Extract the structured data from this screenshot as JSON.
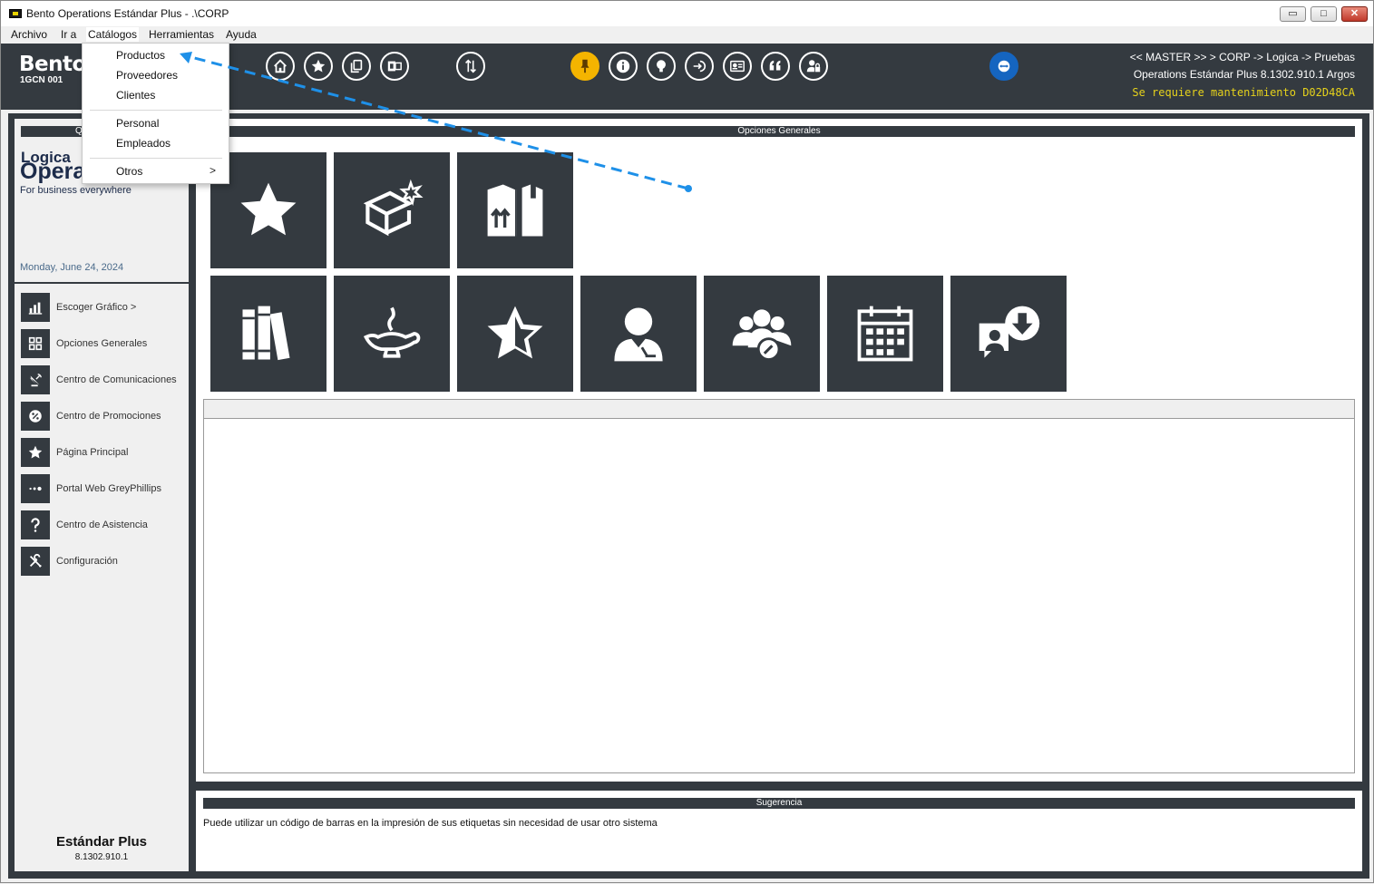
{
  "window": {
    "title": "Bento Operations Estándar Plus - .\\CORP",
    "min_glyph": "▭",
    "max_glyph": "□",
    "close_glyph": "✕"
  },
  "menubar": {
    "items": [
      {
        "label": "Archivo"
      },
      {
        "label": "Ir a"
      },
      {
        "label": "Catálogos"
      },
      {
        "label": "Herramientas"
      },
      {
        "label": "Ayuda"
      }
    ]
  },
  "dropdown": {
    "items": [
      "Productos",
      "Proveedores",
      "Clientes",
      "Personal",
      "Empleados",
      "Otros"
    ],
    "submenu_arrow": ">"
  },
  "header": {
    "brand": "Bento",
    "code": "1GCN 001",
    "path": "<< MASTER >> > CORP -> Logica -> Pruebas",
    "version": "Operations Estándar Plus 8.1302.910.1 Argos",
    "maintenance": "Se requiere mantenimiento D02D48CA",
    "icons": [
      "home-icon",
      "star-icon",
      "copy-icon",
      "office-icon",
      "sort-arrows-icon",
      "pin-icon",
      "info-icon",
      "lightbulb-icon",
      "login-icon",
      "id-card-icon",
      "quote-icon",
      "user-lock-icon",
      "teamviewer-icon"
    ],
    "colors": {
      "bar": "#343a40",
      "highlight": "#f4b400",
      "remote": "#1565c0",
      "warning_text": "#e6d21b"
    }
  },
  "sidebar": {
    "header": "Q",
    "logo_line1": "Logica",
    "logo_line2": "Opera",
    "logo_line3": "For business everywhere",
    "date": "Monday, June 24, 2024",
    "items": [
      {
        "label": "Escoger Gráfico >",
        "icon": "bar-chart-icon"
      },
      {
        "label": "Opciones Generales",
        "icon": "grid-icon"
      },
      {
        "label": "Centro de Comunicaciones",
        "icon": "satellite-dish-icon"
      },
      {
        "label": "Centro de Promociones",
        "icon": "percent-badge-icon"
      },
      {
        "label": "Página Principal",
        "icon": "star-icon"
      },
      {
        "label": "Portal Web GreyPhillips",
        "icon": "dots-icon"
      },
      {
        "label": "Centro de Asistencia",
        "icon": "question-icon"
      },
      {
        "label": "Configuración",
        "icon": "tools-icon"
      }
    ],
    "edition": "Estándar Plus",
    "build": "8.1302.910.1"
  },
  "main": {
    "header": "Opciones Generales",
    "tiles_row1": [
      "star-icon",
      "new-box-icon",
      "boxes-arrows-icon"
    ],
    "tiles_row2": [
      "books-icon",
      "magic-lamp-icon",
      "half-star-icon",
      "user-icon",
      "group-settings-icon",
      "calendar-icon",
      "chat-download-icon"
    ]
  },
  "suggestion": {
    "header": "Sugerencia",
    "text": "Puede utilizar un código de barras en la impresión de sus etiquetas sin necesidad de usar otro sistema"
  }
}
